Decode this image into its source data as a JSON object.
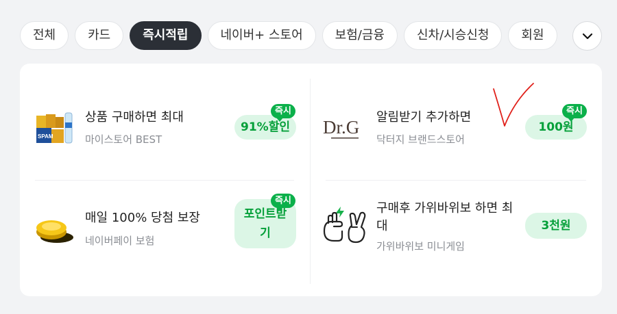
{
  "tabs": [
    {
      "label": "전체",
      "active": false
    },
    {
      "label": "카드",
      "active": false
    },
    {
      "label": "즉시적립",
      "active": true
    },
    {
      "label": "네이버+ 스토어",
      "active": false
    },
    {
      "label": "보험/금융",
      "active": false
    },
    {
      "label": "신차/시승신청",
      "active": false
    },
    {
      "label": "회원",
      "active": false
    }
  ],
  "more_icon": "chevron-down-icon",
  "items": [
    {
      "title": "상품 구매하면 최대",
      "subtitle": "마이스토어 BEST",
      "reward": "91%할인",
      "badge": "즉시",
      "thumb_label": "SPAM"
    },
    {
      "title": "알림받기 추가하면",
      "subtitle": "닥터지 브랜드스토어",
      "reward": "100원",
      "badge": "즉시",
      "thumb_label": "Dr.G"
    },
    {
      "title": "매일 100% 당첨 보장",
      "subtitle": "네이버페이 보험",
      "reward": "포인트받기",
      "badge": "즉시"
    },
    {
      "title": "구매후 가위바위보 하면 최대",
      "subtitle": "가위바위보 미니게임",
      "reward": "3천원",
      "badge": ""
    }
  ],
  "colors": {
    "accent": "#0bb04a",
    "pill_bg": "#dcf6e6",
    "active_tab": "#2b2f36",
    "annotation": "#e0201a"
  }
}
